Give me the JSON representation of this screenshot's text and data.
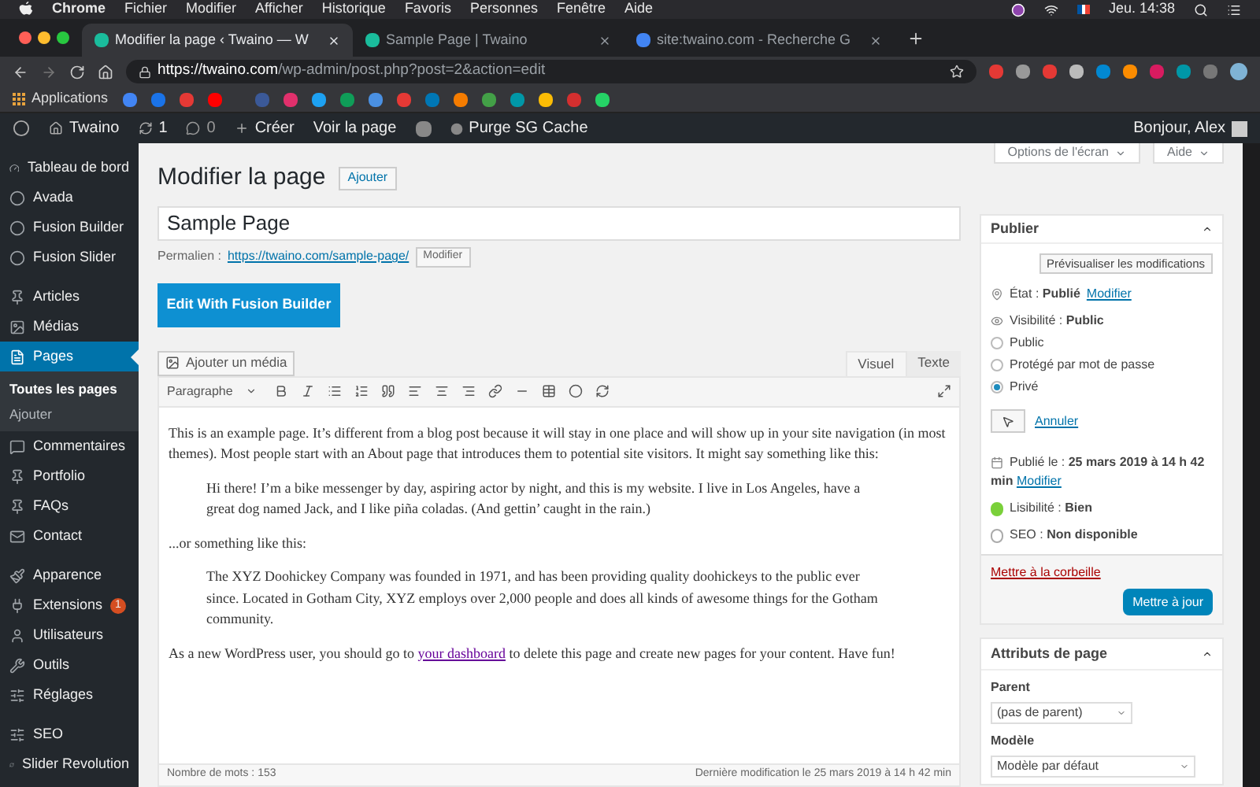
{
  "menubar": {
    "app": "Chrome",
    "menus": [
      "Fichier",
      "Modifier",
      "Afficher",
      "Historique",
      "Favoris",
      "Personnes",
      "Fenêtre",
      "Aide"
    ],
    "clock": "Jeu. 14:38"
  },
  "tabs": [
    {
      "title": "Modifier la page ‹ Twaino — W",
      "selected": true
    },
    {
      "title": "Sample Page | Twaino",
      "selected": false
    },
    {
      "title": "site:twaino.com - Recherche G",
      "selected": false
    }
  ],
  "address": {
    "host": "https://twaino.com",
    "path": "/wp-admin/post.php?post=2&action=edit"
  },
  "bookmarks": {
    "label": "Applications"
  },
  "adminbar": {
    "site": "Twaino",
    "updates": "1",
    "comments": "0",
    "new": "Créer",
    "view": "Voir la page",
    "purge": "Purge SG Cache",
    "greeting": "Bonjour, Alex"
  },
  "sidebar": {
    "groups": [
      [
        {
          "label": "Tableau de bord",
          "selected": false
        },
        {
          "label": "Avada",
          "selected": false
        },
        {
          "label": "Fusion Builder",
          "selected": false
        },
        {
          "label": "Fusion Slider",
          "selected": false
        }
      ],
      [
        {
          "label": "Articles",
          "selected": false
        },
        {
          "label": "Médias",
          "selected": false
        },
        {
          "label": "Pages",
          "selected": true,
          "children": [
            {
              "label": "Toutes les pages",
              "selected": true
            },
            {
              "label": "Ajouter",
              "selected": false
            }
          ]
        },
        {
          "label": "Commentaires",
          "selected": false
        },
        {
          "label": "Portfolio",
          "selected": false
        },
        {
          "label": "FAQs",
          "selected": false
        },
        {
          "label": "Contact",
          "selected": false
        }
      ],
      [
        {
          "label": "Apparence",
          "selected": false
        },
        {
          "label": "Extensions",
          "selected": false,
          "badge": "1"
        },
        {
          "label": "Utilisateurs",
          "selected": false
        },
        {
          "label": "Outils",
          "selected": false
        },
        {
          "label": "Réglages",
          "selected": false
        }
      ],
      [
        {
          "label": "SEO",
          "selected": false
        },
        {
          "label": "Slider Revolution",
          "selected": false
        }
      ]
    ]
  },
  "screen_options": [
    "Options de l'écran",
    "Aide"
  ],
  "page_title": "Modifier la page",
  "add_button": "Ajouter",
  "title_field": {
    "value": "Sample Page"
  },
  "permalink": {
    "label": "Permalien :",
    "url": "https://twaino.com/sample-page/",
    "button": "Modifier"
  },
  "fusion_button": "Edit With Fusion Builder",
  "media_button": "Ajouter un média",
  "editor_tabs": [
    {
      "label": "Visuel",
      "selected": true
    },
    {
      "label": "Texte",
      "selected": false
    }
  ],
  "format_select": "Paragraphe",
  "content": [
    {
      "kind": "p",
      "text": "This is an example page. It’s different from a blog post because it will stay in one place and will show up in your site navigation (in most themes). Most people start with an About page that introduces them to potential site visitors. It might say something like this:"
    },
    {
      "kind": "quote",
      "text": "Hi there! I’m a bike messenger by day, aspiring actor by night, and this is my website. I live in Los Angeles, have a great dog named Jack, and I like piña coladas. (And gettin’ caught in the rain.)"
    },
    {
      "kind": "p",
      "text": "...or something like this:"
    },
    {
      "kind": "quote",
      "text": "The XYZ Doohickey Company was founded in 1971, and has been providing quality doohickeys to the public ever since. Located in Gotham City, XYZ employs over 2,000 people and does all kinds of awesome things for the Gotham community."
    },
    {
      "kind": "p",
      "text": "As a new WordPress user, you should go to ",
      "link": "your dashboard",
      "after": " to delete this page and create new pages for your content. Have fun!"
    }
  ],
  "word_count": "Nombre de mots : 153",
  "last_modified": "Dernière modification le 25 mars 2019 à 14 h 42 min",
  "publish": {
    "title": "Publier",
    "preview": "Prévisualiser les modifications",
    "status": "État : **Publié**",
    "status_link": "Modifier",
    "visibility": "Visibilité : **Public**",
    "options": [
      {
        "label": "Public",
        "selected": false
      },
      {
        "label": "Protégé par mot de passe",
        "selected": false
      },
      {
        "label": "Privé",
        "selected": true
      }
    ],
    "cancel": "Annuler",
    "date": "Publié le : **25 mars 2019 à 14 h 42 min**",
    "date_link": "Modifier",
    "readability": "Lisibilité : **Bien**",
    "seo": "SEO : **Non disponible**",
    "trash": "Mettre à la corbeille",
    "update": "Mettre à jour"
  },
  "attributes": {
    "title": "Attributs de page",
    "parent_label": "Parent",
    "parent": "(pas de parent)",
    "template_label": "Modèle",
    "template": "Modèle par défaut"
  }
}
